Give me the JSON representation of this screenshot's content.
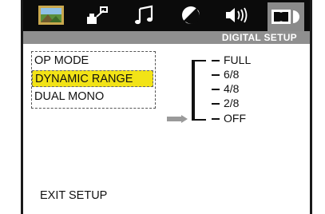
{
  "header": {
    "title": "DIGITAL SETUP",
    "tabs": [
      {
        "icon": "general-setup-icon",
        "active": false
      },
      {
        "icon": "speaker-setup-icon",
        "active": false
      },
      {
        "icon": "music-note-icon",
        "active": false
      },
      {
        "icon": "video-setup-icon",
        "active": false
      },
      {
        "icon": "speaker-sound-icon",
        "active": false
      },
      {
        "icon": "dolby-digital-icon",
        "active": true
      }
    ]
  },
  "menu": {
    "items": [
      "OP MODE",
      "DYNAMIC RANGE",
      "DUAL MONO"
    ],
    "selected": "DYNAMIC RANGE"
  },
  "options": {
    "items": [
      "FULL",
      "6/8",
      "4/8",
      "2/8",
      "OFF"
    ],
    "current": "OFF"
  },
  "footer": {
    "exit_label": "EXIT SETUP"
  },
  "colors": {
    "highlight": "#f2e316",
    "titlebar": "#8f8f8f",
    "iconbar": "#0b0b0b"
  }
}
